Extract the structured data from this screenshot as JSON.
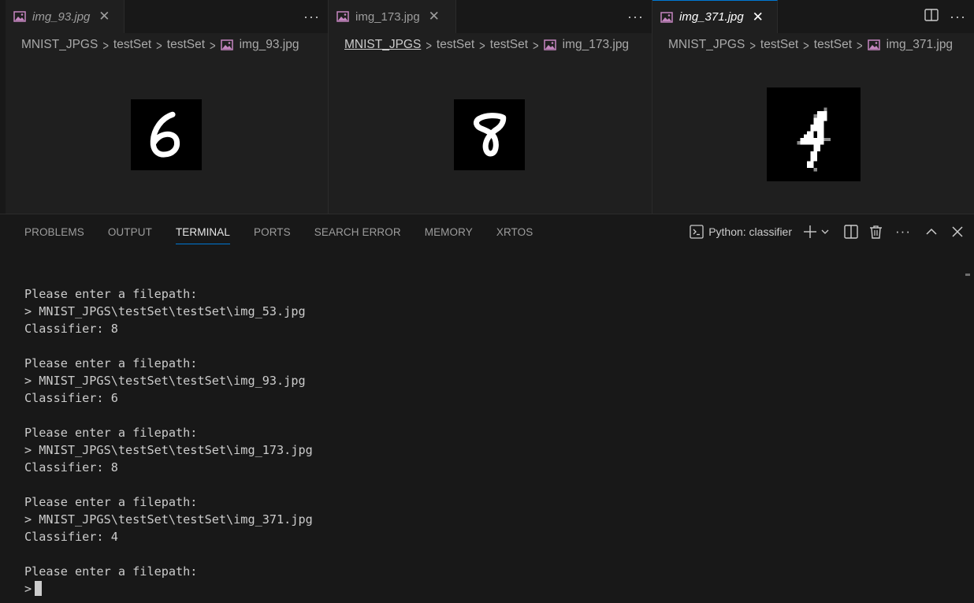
{
  "editor_groups": [
    {
      "tab": {
        "label": "img_93.jpg",
        "active": false,
        "italic": true
      },
      "breadcrumb": [
        "MNIST_JPGS",
        "testSet",
        "testSet",
        "img_93.jpg"
      ],
      "digit": "6"
    },
    {
      "tab": {
        "label": "img_173.jpg",
        "active": false,
        "italic": false
      },
      "breadcrumb": [
        "MNIST_JPGS",
        "testSet",
        "testSet",
        "img_173.jpg"
      ],
      "digit": "8"
    },
    {
      "tab": {
        "label": "img_371.jpg",
        "active": true,
        "italic": true
      },
      "breadcrumb": [
        "MNIST_JPGS",
        "testSet",
        "testSet",
        "img_371.jpg"
      ],
      "digit": "4"
    }
  ],
  "panel": {
    "tabs": [
      "PROBLEMS",
      "OUTPUT",
      "TERMINAL",
      "PORTS",
      "SEARCH ERROR",
      "MEMORY",
      "XRTOS"
    ],
    "active_tab": "TERMINAL",
    "terminal_name": "Python: classifier"
  },
  "terminal": {
    "lines": [
      "Please enter a filepath:",
      "> MNIST_JPGS\\testSet\\testSet\\img_53.jpg",
      "Classifier: 8",
      "",
      "Please enter a filepath:",
      "> MNIST_JPGS\\testSet\\testSet\\img_93.jpg",
      "Classifier: 6",
      "",
      "Please enter a filepath:",
      "> MNIST_JPGS\\testSet\\testSet\\img_173.jpg",
      "Classifier: 8",
      "",
      "Please enter a filepath:",
      "> MNIST_JPGS\\testSet\\testSet\\img_371.jpg",
      "Classifier: 4",
      "",
      "Please enter a filepath:"
    ],
    "prompt": ">"
  },
  "colors": {
    "accent": "#0078d4",
    "image_icon": "#c586c0",
    "background": "#181818",
    "editor_background": "#1f1f1f"
  },
  "icons": {
    "tab_file": "image-file-icon",
    "split_editor": "split-editor-icon",
    "more_actions": "ellipsis-icon",
    "terminal": "terminal-icon",
    "new_terminal": "plus-icon",
    "dropdown": "chevron-down-icon",
    "split_terminal": "split-terminal-icon",
    "kill_terminal": "trash-icon",
    "maximize": "chevron-up-icon",
    "close_panel": "close-icon"
  }
}
